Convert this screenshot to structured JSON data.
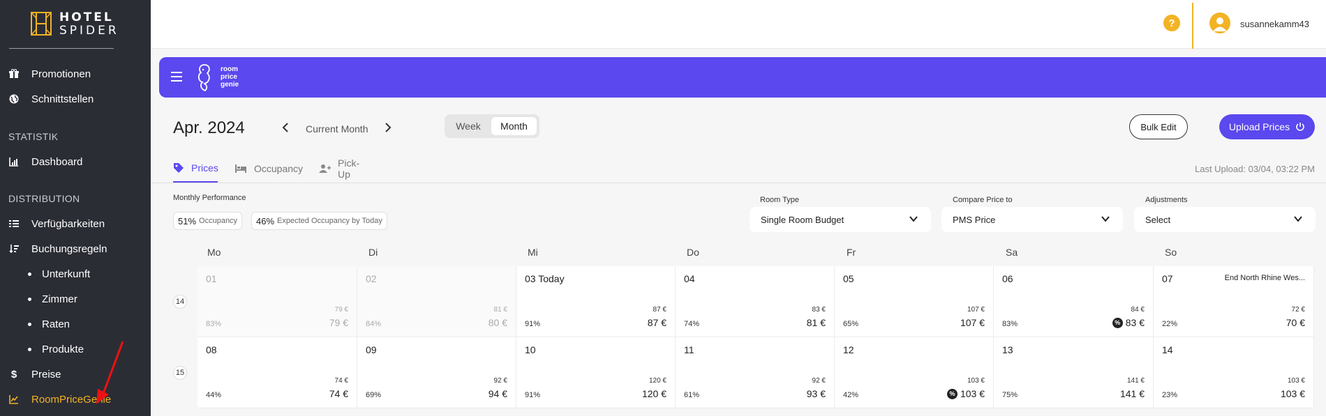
{
  "sidebar": {
    "logo_line1": "HOTEL",
    "logo_line2": "SPIDER",
    "items_top": [
      {
        "label": "Promotionen",
        "icon": "gift-icon"
      },
      {
        "label": "Schnittstellen",
        "icon": "globe-icon"
      }
    ],
    "section_statistik": "STATISTIK",
    "dashboard_label": "Dashboard",
    "section_distribution": "DISTRIBUTION",
    "verfuegbarkeiten_label": "Verfügbarkeiten",
    "buchungsregeln_label": "Buchungsregeln",
    "sub_items": [
      "Unterkunft",
      "Zimmer",
      "Raten",
      "Produkte"
    ],
    "preise_label": "Preise",
    "roompricegenie_label": "RoomPriceGenie"
  },
  "header": {
    "help_glyph": "?",
    "username": "susannekamm43"
  },
  "rpg": {
    "logo_text": [
      "room",
      "price",
      "genie"
    ]
  },
  "toolbar": {
    "month_title": "Apr. 2024",
    "current_month": "Current Month",
    "view_week": "Week",
    "view_month": "Month",
    "bulk_edit": "Bulk Edit",
    "upload_prices": "Upload Prices"
  },
  "tabs": {
    "prices": "Prices",
    "occupancy": "Occupancy",
    "pickup": "Pick-Up",
    "last_upload": "Last Upload: 03/04, 03:22 PM"
  },
  "performance": {
    "label": "Monthly Performance",
    "occ_value": "51%",
    "occ_text": "Occupancy",
    "exp_value": "46%",
    "exp_text": "Expected Occupancy by Today"
  },
  "filters": {
    "room_type_label": "Room Type",
    "room_type_value": "Single Room Budget",
    "compare_label": "Compare Price to",
    "compare_value": "PMS Price",
    "adjust_label": "Adjustments",
    "adjust_value": "Select"
  },
  "calendar": {
    "weekdays": [
      "Mo",
      "Di",
      "Mi",
      "Do",
      "Fr",
      "Sa",
      "So"
    ],
    "weeks": [
      {
        "num": "14",
        "days": [
          {
            "day": "01",
            "pms": "79 €",
            "price": "79 €",
            "occ": "83%",
            "past": true
          },
          {
            "day": "02",
            "pms": "81 €",
            "price": "80 €",
            "occ": "84%",
            "past": true
          },
          {
            "day": "03 Today",
            "pms": "87 €",
            "price": "87 €",
            "occ": "91%"
          },
          {
            "day": "04",
            "pms": "83 €",
            "price": "81 €",
            "occ": "74%"
          },
          {
            "day": "05",
            "pms": "107 €",
            "price": "107 €",
            "occ": "65%"
          },
          {
            "day": "06",
            "pms": "84 €",
            "price": "83 €",
            "occ": "83%",
            "badge": "%"
          },
          {
            "day": "07",
            "pms": "72 €",
            "price": "70 €",
            "occ": "22%",
            "event": "End North Rhine Wes..."
          }
        ]
      },
      {
        "num": "15",
        "days": [
          {
            "day": "08",
            "pms": "74 €",
            "price": "74 €",
            "occ": "44%"
          },
          {
            "day": "09",
            "pms": "92 €",
            "price": "94 €",
            "occ": "69%"
          },
          {
            "day": "10",
            "pms": "120 €",
            "price": "120 €",
            "occ": "91%"
          },
          {
            "day": "11",
            "pms": "92 €",
            "price": "93 €",
            "occ": "61%"
          },
          {
            "day": "12",
            "pms": "103 €",
            "price": "103 €",
            "occ": "42%",
            "badge": "%"
          },
          {
            "day": "13",
            "pms": "141 €",
            "price": "141 €",
            "occ": "75%"
          },
          {
            "day": "14",
            "pms": "103 €",
            "price": "103 €",
            "occ": "23%"
          }
        ]
      }
    ]
  },
  "colors": {
    "sidebar_bg": "#2b2d35",
    "accent_yellow": "#f2b324",
    "accent_purple": "#5b48ee"
  }
}
